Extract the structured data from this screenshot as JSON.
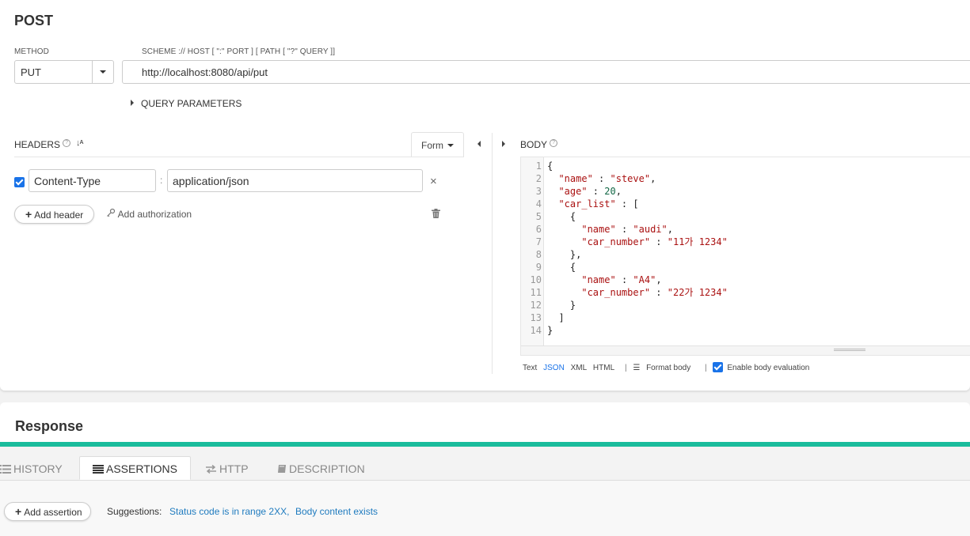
{
  "request": {
    "title": "POST",
    "method_label": "METHOD",
    "method_value": "PUT",
    "url_label": "SCHEME :// HOST [ \":\" PORT ] [ PATH [ \"?\" QUERY ]]",
    "url_value": "http://localhost:8080/api/put",
    "query_toggle": "QUERY PARAMETERS"
  },
  "headers": {
    "title": "HEADERS",
    "form_label": "Form",
    "rows": [
      {
        "enabled": true,
        "name": "Content-Type",
        "value": "application/json"
      }
    ],
    "add_header": "Add header",
    "add_authorization": "Add authorization"
  },
  "body": {
    "title": "BODY",
    "lines": [
      "{",
      "  \"name\" : \"steve\",",
      "  \"age\" : 20,",
      "  \"car_list\" : [",
      "    {",
      "      \"name\" : \"audi\",",
      "      \"car_number\" : \"11가 1234\"",
      "    },",
      "    {",
      "      \"name\" : \"A4\",",
      "      \"car_number\" : \"22가 1234\"",
      "    }",
      "  ]",
      "}"
    ],
    "formats": [
      "Text",
      "JSON",
      "XML",
      "HTML"
    ],
    "active_format": "JSON",
    "format_body": "Format body",
    "enable_evaluation": "Enable body evaluation",
    "enable_evaluation_checked": true
  },
  "response": {
    "title": "Response",
    "tabs": [
      {
        "label": "HISTORY",
        "icon": "list-icon",
        "active": false
      },
      {
        "label": "ASSERTIONS",
        "icon": "assertions-icon",
        "active": true
      },
      {
        "label": "HTTP",
        "icon": "exchange-icon",
        "active": false
      },
      {
        "label": "DESCRIPTION",
        "icon": "book-icon",
        "active": false
      }
    ],
    "add_assertion": "Add assertion",
    "suggestions_label": "Suggestions:",
    "suggestions": [
      "Status code is in range 2XX,",
      "Body content exists"
    ]
  },
  "colors": {
    "accent": "#1abc9c",
    "link": "#1f7bbf",
    "checkbox": "#1a73e8"
  }
}
